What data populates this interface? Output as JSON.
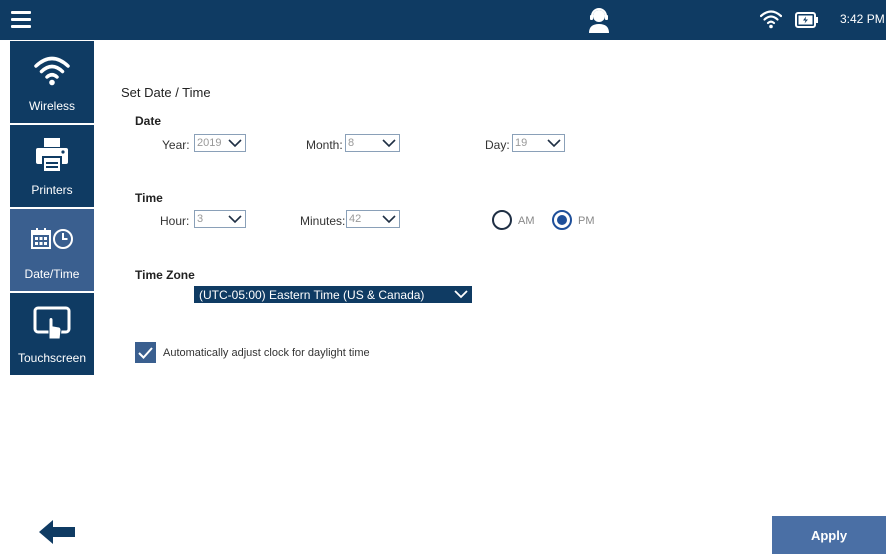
{
  "status_bar": {
    "time": "3:42 PM"
  },
  "sidebar": {
    "items": [
      {
        "label": "Wireless",
        "icon": "wifi-icon"
      },
      {
        "label": "Printers",
        "icon": "printer-icon"
      },
      {
        "label": "Date/Time",
        "icon": "calendar-clock-icon",
        "active": true
      },
      {
        "label": "Touchscreen",
        "icon": "touchscreen-icon"
      }
    ]
  },
  "main": {
    "title": "Set Date / Time",
    "date": {
      "section_label": "Date",
      "year_label": "Year:",
      "year_value": "2019",
      "month_label": "Month:",
      "month_value": "8",
      "day_label": "Day:",
      "day_value": "19"
    },
    "time": {
      "section_label": "Time",
      "hour_label": "Hour:",
      "hour_value": "3",
      "minutes_label": "Minutes:",
      "minutes_value": "42",
      "am_label": "AM",
      "pm_label": "PM",
      "selected": "PM"
    },
    "timezone": {
      "section_label": "Time Zone",
      "value": "(UTC-05:00) Eastern Time (US & Canada)"
    },
    "dst": {
      "label": "Automatically adjust clock for daylight time",
      "checked": true
    }
  },
  "footer": {
    "apply_label": "Apply"
  },
  "colors": {
    "topbar": "#0f3b63",
    "sidebar": "#0f3b63",
    "sidebar_active": "#3a5f8f",
    "apply_button": "#4a6fa5",
    "dropdown_border": "#8aa0b8"
  }
}
